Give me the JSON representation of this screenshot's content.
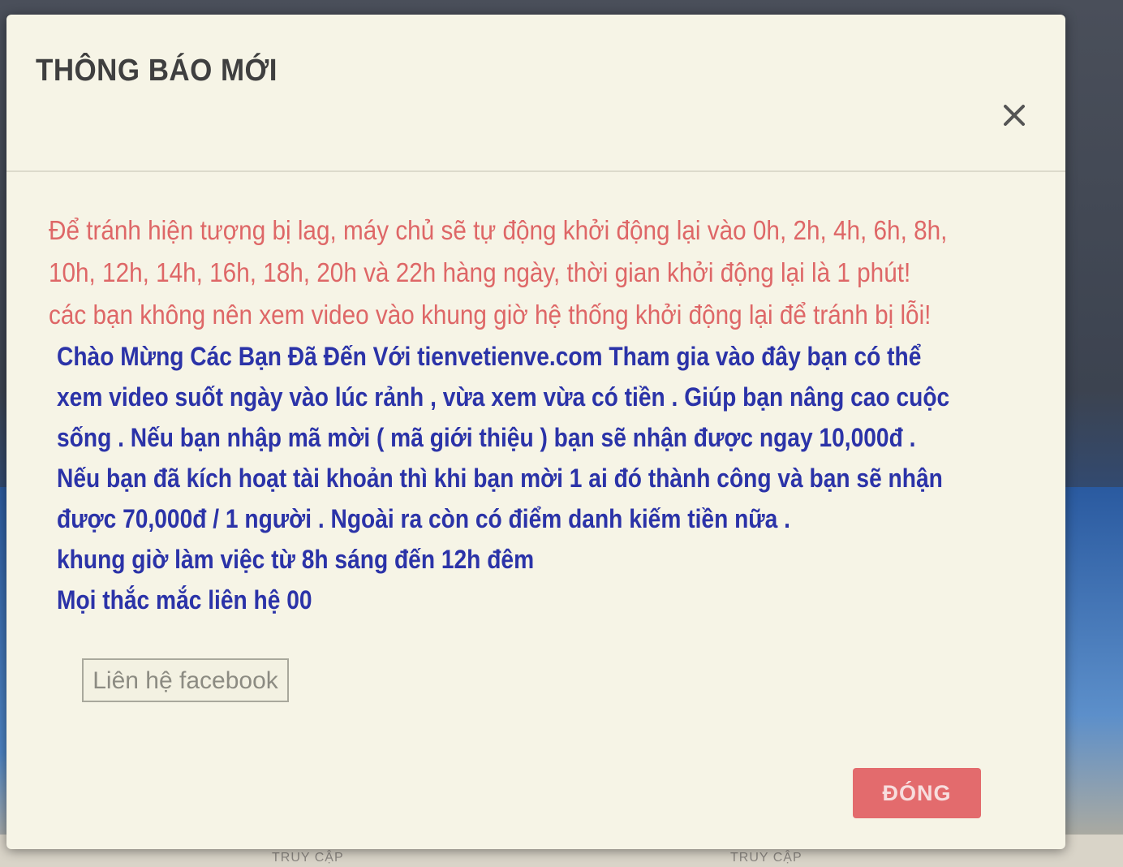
{
  "modal": {
    "title": "THÔNG BÁO MỚI",
    "notice_red_lines": [
      "Để tránh hiện tượng bị lag, máy chủ sẽ tự động khởi động lại vào 0h, 2h, 4h, 6h, 8h,",
      "10h, 12h, 14h, 16h, 18h, 20h và 22h hàng ngày, thời gian khởi động lại là 1 phút!",
      "các bạn không nên xem video vào khung giờ hệ thống khởi động lại để tránh bị lỗi!"
    ],
    "notice_blue_lines": [
      "Chào Mừng Các Bạn Đã Đến Với tienvetienve.com Tham gia vào đây bạn có thể",
      "xem video suốt ngày vào lúc rảnh , vừa xem vừa có tiền . Giúp bạn nâng cao cuộc",
      "sống . Nếu bạn nhập mã mời ( mã giới thiệu ) bạn sẽ nhận được ngay 10,000đ .",
      "Nếu bạn đã kích hoạt tài khoản thì khi bạn mời 1 ai đó thành công và bạn sẽ nhận",
      "được 70,000đ / 1 người . Ngoài ra còn có điểm danh kiếm tiền nữa .",
      "khung giờ làm việc từ 8h sáng đến 12h đêm",
      "Mọi thắc mắc liên hệ 00"
    ],
    "facebook_button_label": "Liên hệ facebook",
    "close_button_label": "ĐÓNG",
    "close_icon": "close-icon"
  },
  "background": {
    "bottom_labels": [
      "TRUY CẬP",
      "TRUY CẬP"
    ]
  },
  "colors": {
    "red_text": "#de6767",
    "blue_text": "#2b33a8",
    "close_button": "#e36b6d"
  }
}
